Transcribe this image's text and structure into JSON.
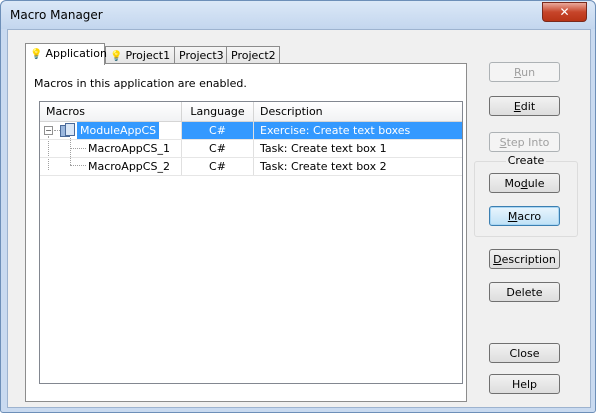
{
  "window": {
    "title": "Macro Manager",
    "close_glyph": "✕"
  },
  "tabs": [
    {
      "label": "Application",
      "active": true,
      "icon": "bulb-icon"
    },
    {
      "label": "Project1",
      "active": false,
      "icon": "bulb-icon"
    },
    {
      "label": "Project3",
      "active": false
    },
    {
      "label": "Project2",
      "active": false
    }
  ],
  "panel": {
    "info": "Macros in this application are enabled."
  },
  "tree": {
    "columns": [
      "Macros",
      "Language",
      "Description"
    ],
    "rows": [
      {
        "name": "ModuleAppCS",
        "language": "C#",
        "description": "Exercise: Create text boxes",
        "selected": true,
        "expander": "−"
      },
      {
        "name": "MacroAppCS_1",
        "language": "C#",
        "description": "Task: Create text box 1",
        "selected": false
      },
      {
        "name": "MacroAppCS_2",
        "language": "C#",
        "description": "Task: Create text box 2",
        "selected": false
      }
    ]
  },
  "buttons": {
    "run": {
      "pre": "",
      "u": "R",
      "post": "un"
    },
    "edit": {
      "pre": "",
      "u": "E",
      "post": "dit"
    },
    "step_into": {
      "pre": "",
      "u": "S",
      "post": "tep Into"
    },
    "create_label": "Create",
    "module": {
      "pre": "Mo",
      "u": "d",
      "post": "ule"
    },
    "macro": {
      "pre": "",
      "u": "M",
      "post": "acro"
    },
    "description": {
      "pre": "",
      "u": "D",
      "post": "escription"
    },
    "delete": "Delete",
    "close": "Close",
    "help": "Help"
  },
  "colors": {
    "selection": "#3399ff",
    "accent": "#3c7fb1"
  }
}
